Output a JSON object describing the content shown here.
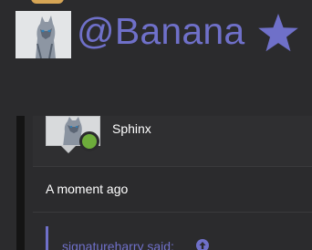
{
  "header": {
    "username": "@Banana",
    "star_icon": "star-icon",
    "accent_color": "#6f70c9"
  },
  "post": {
    "poster_name": "Sphinx",
    "online": true,
    "timestamp": "A moment ago"
  },
  "quote": {
    "header": "signatureharry said:",
    "jump_icon": "arrow-up-circle-icon"
  }
}
